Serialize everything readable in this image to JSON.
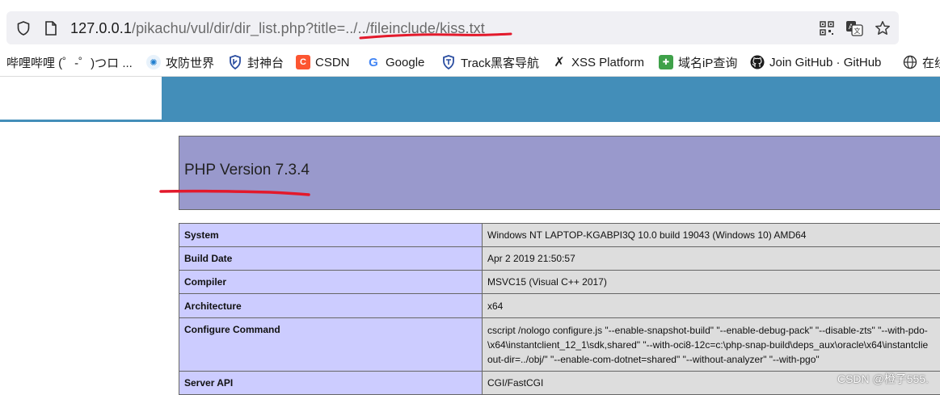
{
  "browser": {
    "url_host": "127.0.0.1",
    "url_path": "/pikachu/vul/dir/dir_list.php?title=../../fileinclude/kiss.txt"
  },
  "bookmarks": [
    {
      "label": "哔哩哔哩 (゜-゜)つロ ...",
      "icon": "bilibili-icon"
    },
    {
      "label": "攻防世界",
      "icon": "adworld-icon"
    },
    {
      "label": "封神台",
      "icon": "shield-icon"
    },
    {
      "label": "CSDN",
      "icon": "csdn-icon"
    },
    {
      "label": "Google",
      "icon": "google-icon"
    },
    {
      "label": "Track黑客导航",
      "icon": "track-icon"
    },
    {
      "label": "XSS Platform",
      "icon": "xss-icon"
    },
    {
      "label": "域名iP查询",
      "icon": "domain-icon"
    },
    {
      "label": "Join GitHub · GitHub",
      "icon": "github-icon"
    },
    {
      "label": "在线",
      "icon": "globe-icon"
    }
  ],
  "page": {
    "php_version_title": "PHP Version 7.3.4",
    "rows": [
      {
        "key": "System",
        "value": "Windows NT LAPTOP-KGABPI3Q 10.0 build 19043 (Windows 10) AMD64"
      },
      {
        "key": "Build Date",
        "value": "Apr 2 2019 21:50:57"
      },
      {
        "key": "Compiler",
        "value": "MSVC15 (Visual C++ 2017)"
      },
      {
        "key": "Architecture",
        "value": "x64"
      },
      {
        "key": "Configure Command",
        "value_lines": [
          "cscript /nologo configure.js \"--enable-snapshot-build\" \"--enable-debug-pack\" \"--disable-zts\" \"--with-pdo-",
          "\\x64\\instantclient_12_1\\sdk,shared\" \"--with-oci8-12c=c:\\php-snap-build\\deps_aux\\oracle\\x64\\instantclie",
          "out-dir=../obj/\" \"--enable-com-dotnet=shared\" \"--without-analyzer\" \"--with-pgo\""
        ]
      },
      {
        "key": "Server API",
        "value": "CGI/FastCGI"
      }
    ]
  },
  "watermark": "CSDN @橙子555.",
  "colors": {
    "banner": "#438eb9",
    "php_header": "#9999cc",
    "key_cell": "#ccccff",
    "value_cell": "#dddddd",
    "annotation": "#e3192b"
  }
}
